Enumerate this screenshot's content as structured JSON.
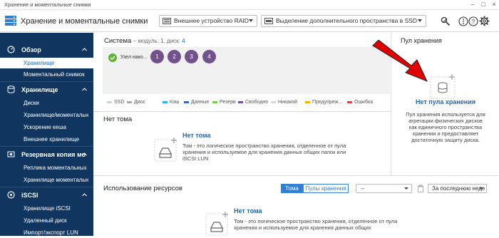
{
  "window": {
    "title": "Хранение и моментальные снимки"
  },
  "header": {
    "app_title": "Хранение и моментальные снимки",
    "device_select": "Внешнее устройство RAID",
    "ssd_select": "Выделение дополнительного пространства в SSD"
  },
  "sidebar": {
    "sections": [
      {
        "label": "Обзор",
        "icon": "overview-icon",
        "items": [
          "Хранилище",
          "Моментальный снимок"
        ]
      },
      {
        "label": "Хранилище",
        "icon": "storage-icon",
        "items": [
          "Диски",
          "Хранилище/моментальн",
          "Ускорение кеша",
          "Внешнее хранилище"
        ]
      },
      {
        "label": "Резервная копия мо",
        "icon": "backup-icon",
        "items": [
          "Реплика моментальных",
          "Хранилище моментальн"
        ]
      },
      {
        "label": "iSCSI",
        "icon": "iscsi-icon",
        "items": [
          "Хранилище iSCSI",
          "Удаленный диск",
          "Импорт/экспорт LUN"
        ]
      }
    ]
  },
  "system": {
    "title": "Система",
    "meta_prefix": "– модуль: ",
    "module_count": "1",
    "meta_middle": ", диск: ",
    "disk_count": "4",
    "node_label": "Узел нако...",
    "disks": [
      "1",
      "2",
      "3",
      "4"
    ]
  },
  "legend": [
    {
      "label": "SSD",
      "color": "#cfcfcf"
    },
    {
      "label": "Диск",
      "color": "#a8a8a8"
    },
    {
      "label": "Кэш",
      "color": "#29b6d8"
    },
    {
      "label": "Данные",
      "color": "#2e6cc2"
    },
    {
      "label": "Резерв",
      "color": "#7ac943"
    },
    {
      "label": "Свободно",
      "color": "#7b4ca3"
    },
    {
      "label": "Никакой",
      "color": "#d9d9d9"
    },
    {
      "label": "Предупреж...",
      "color": "#f7b500"
    },
    {
      "label": "Ошибка",
      "color": "#e8413a"
    }
  ],
  "pool": {
    "title": "Пул хранения",
    "empty_title": "Нет пула хранения",
    "description": "Пул хранения используется для агрегации физических дисков как единичного пространства хранения и предоставляет достаточную защиту диска."
  },
  "volume": {
    "title": "Нет тома",
    "empty_title": "Нет тома",
    "description": "Том - это логическое пространство хранения, отделенное от пула хранения и используемое для хранения данных общих папок или iSCSI LUN"
  },
  "usage": {
    "title": "Использование ресурсов",
    "tabs": [
      "Тома",
      "Пулы хранения"
    ],
    "active_tab": "Тома",
    "filter_value": "--",
    "period": "За последнюю неде",
    "empty_title": "Нет тома",
    "description": "Том - это логическое пространство хранения, отделенное от пула хранения и используемое для хранения данных общих"
  },
  "colors": {
    "sidebar_bg": "#10365f",
    "accent": "#1f66b5",
    "disk": "#71528d",
    "arrow": "#e00000"
  }
}
